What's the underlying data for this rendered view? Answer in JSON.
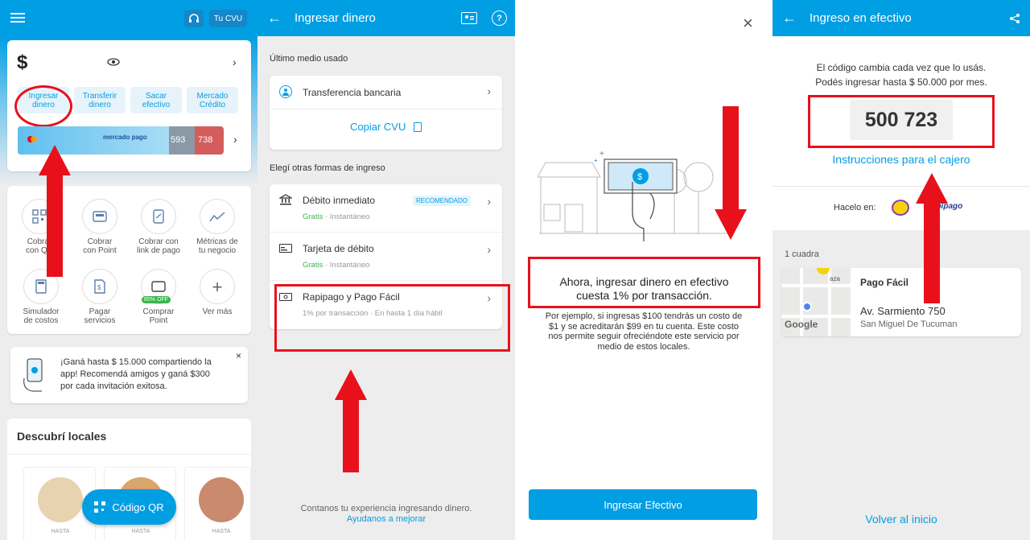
{
  "colors": {
    "brand": "#009ee3",
    "annotation_red": "#e8111b",
    "success": "#39b54a"
  },
  "s1": {
    "header": {
      "cvu_label": "Tu CVU",
      "menu_icon": "hamburger-icon",
      "support_icon": "headset-icon"
    },
    "balance": {
      "currency": "$"
    },
    "actions": [
      {
        "line1": "Ingresar",
        "line2": "dinero"
      },
      {
        "line1": "Transferir",
        "line2": "dinero"
      },
      {
        "line1": "Sacar",
        "line2": "efectivo"
      },
      {
        "line1": "Mercado",
        "line2": "Crédito"
      }
    ],
    "cards": {
      "brand": "mercado pago",
      "digits1": "593",
      "digits2": "738"
    },
    "tools": [
      {
        "l1": "Cobrar",
        "l2": "con QR"
      },
      {
        "l1": "Cobrar",
        "l2": "con Point"
      },
      {
        "l1": "Cobrar con",
        "l2": "link de pago"
      },
      {
        "l1": "Métricas de",
        "l2": "tu negocio"
      },
      {
        "l1": "Simulador",
        "l2": "de costos"
      },
      {
        "l1": "Pagar",
        "l2": "servicios"
      },
      {
        "l1": "Comprar",
        "l2": "Point",
        "badge": "85% OFF"
      },
      {
        "l1": "Ver más",
        "l2": ""
      }
    ],
    "promo": {
      "text1": "¡Ganá hasta $ 15.000 compartiendo la",
      "text2": "app! Recomendá amigos y ganá $300",
      "text3": "por cada invitación exitosa."
    },
    "discover": {
      "title": "Descubrí locales",
      "hasta": "HASTA"
    },
    "qr_button": "Código QR"
  },
  "s2": {
    "title": "Ingresar dinero",
    "last_used": "Último medio usado",
    "transfer": "Transferencia bancaria",
    "copy_cvu": "Copiar CVU",
    "other": "Elegí otras formas de ingreso",
    "options": [
      {
        "name": "Débito inmediato",
        "badge": "RECOMENDADO",
        "free": "Gratis",
        "speed": "· Instantáneo"
      },
      {
        "name": "Tarjeta de débito",
        "free": "Gratis",
        "speed": "· Instantáneo"
      },
      {
        "name": "Rapipago y Pago Fácil",
        "sub": "1% por transacción · En hasta 1 día hábil"
      }
    ],
    "footer": "Contanos tu experiencia ingresando dinero.",
    "footer_link": "Ayudanos a mejorar"
  },
  "s3": {
    "headline1": "Ahora, ingresar dinero en efectivo",
    "headline2": "cuesta 1% por transacción.",
    "body1": "Por ejemplo, si ingresas $100 tendrás un costo de",
    "body2": "$1 y se acreditarán $99 en tu cuenta. Este costo",
    "body3": "nos permite seguir ofreciéndote este servicio por",
    "body4": "medio de estos locales.",
    "cta": "Ingresar Efectivo"
  },
  "s4": {
    "title": "Ingreso en efectivo",
    "info1": "El código cambia cada vez que lo usás.",
    "info2": "Podés ingresar hasta $ 50.000 por mes.",
    "code": "500 723",
    "instructions": "Instrucciones para el cajero",
    "hacelo": "Hacelo en:",
    "rapipago": "rapipago",
    "distance": "1 cuadra",
    "store_name": "Pago Fácil",
    "address": "Av. Sarmiento 750",
    "city": "San Miguel De Tucuman",
    "map_brand": "Google",
    "map_label": "aza",
    "back": "Volver al inicio"
  }
}
